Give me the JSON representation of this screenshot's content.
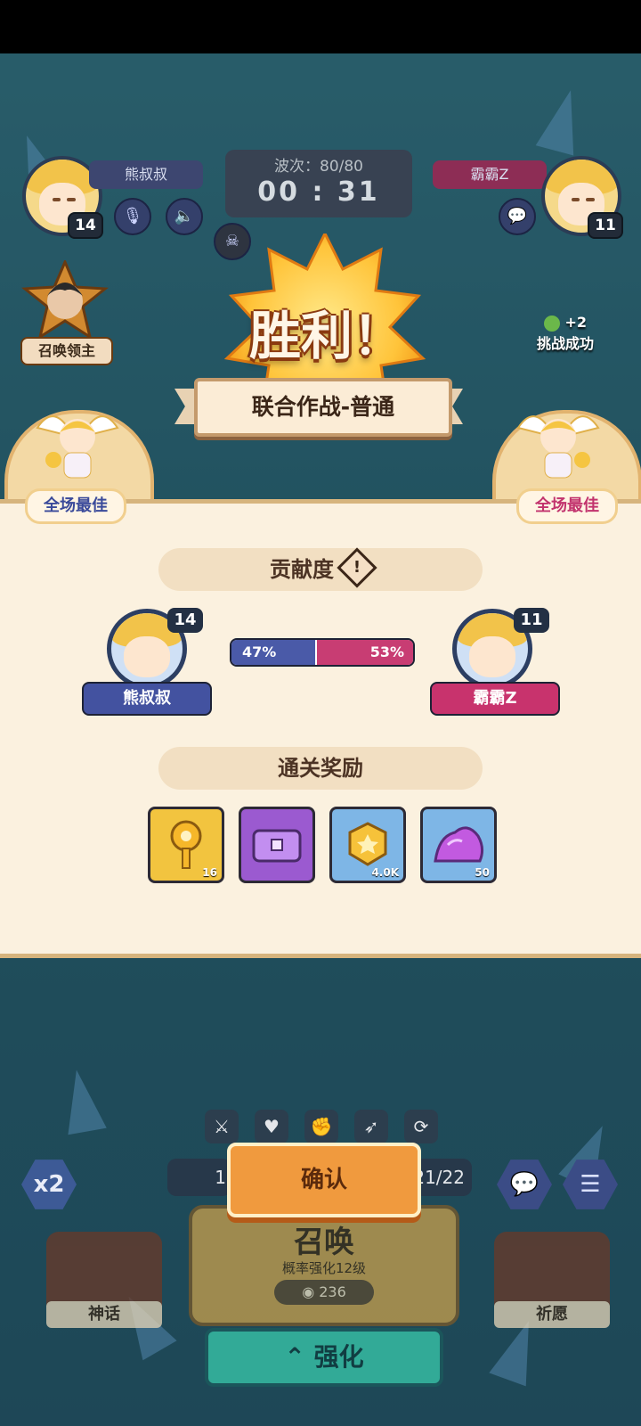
{
  "players": {
    "left": {
      "name": "熊叔叔",
      "level": "14"
    },
    "right": {
      "name": "霸霸Z",
      "level": "11"
    }
  },
  "match": {
    "wave": "波次：80/80",
    "timer": "00 : 31"
  },
  "victory": {
    "title": "胜利！",
    "mode": "联合作战-普通"
  },
  "summon_lord": "召唤领主",
  "challenge": {
    "reward": "+2",
    "text": "挑战成功"
  },
  "mvp": {
    "left": "全场最佳",
    "right": "全场最佳"
  },
  "contribution": {
    "title": "贡献度",
    "left_percent": "47%",
    "right_percent": "53%",
    "left_value": 0.47
  },
  "rewards": {
    "title": "通关奖励",
    "items": [
      {
        "icon": "key-icon",
        "count": "16"
      },
      {
        "icon": "chest-icon",
        "count": ""
      },
      {
        "icon": "coin-icon",
        "count": "4.0K"
      },
      {
        "icon": "crystal-icon",
        "count": "50"
      }
    ]
  },
  "bottom": {
    "confirm": "确认",
    "speed": "x2",
    "summon": {
      "title": "召唤",
      "subtitle": "概率强化12级",
      "cost": "236"
    },
    "myth": "神话",
    "wish": "祈愿",
    "enhance": "强化",
    "left_count": "1",
    "right_count": "21/22"
  },
  "colors": {
    "left_player": "#4a5aa8",
    "right_player": "#c83d73",
    "confirm": "#f09a3e"
  }
}
